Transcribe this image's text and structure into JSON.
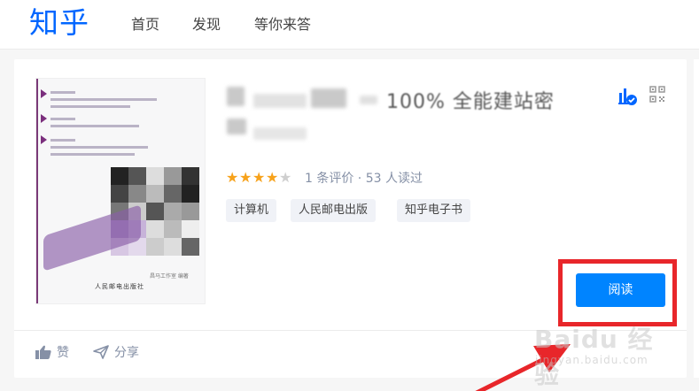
{
  "header": {
    "logo": "知乎",
    "nav": [
      "首页",
      "发现",
      "等你来答"
    ]
  },
  "book": {
    "title_visible_fragment": "100% 全能建站密",
    "rating": {
      "stars_filled": 4,
      "stars_total": 5,
      "summary": "1 条评价 · 53 人读过"
    },
    "tags": [
      "计算机",
      "人民邮电出版",
      "知乎电子书"
    ],
    "cover": {
      "publisher": "人民邮电出版社",
      "author": "昌马工作室 编著"
    }
  },
  "actions": {
    "read_label": "阅读",
    "like_label": "赞",
    "share_label": "分享"
  },
  "watermark": {
    "brand": "Baidu 经验",
    "url": "jingyan.baidu.com"
  },
  "colors": {
    "brand_blue": "#0066ff",
    "button_blue": "#0084ff",
    "highlight_red": "#e8262a",
    "star": "#f7a21b"
  },
  "icons": {
    "stat": "bar-chart-check-icon",
    "qr": "qr-code-icon",
    "like": "thumbs-up-icon",
    "share": "paper-plane-icon"
  }
}
